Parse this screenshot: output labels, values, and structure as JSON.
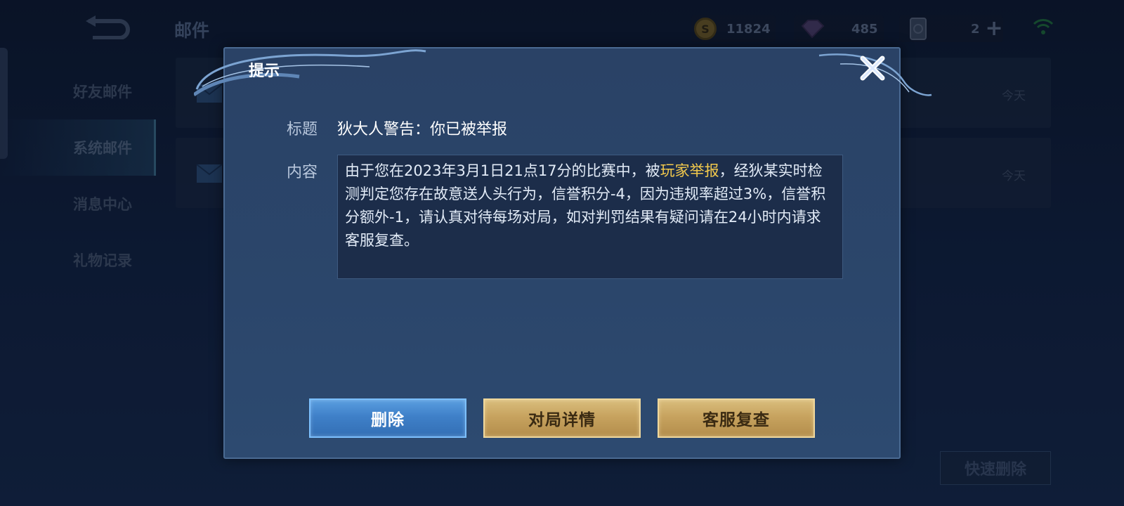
{
  "header": {
    "page_title": "邮件",
    "gold": "11824",
    "gems": "485",
    "tickets": "2"
  },
  "sidebar": {
    "items": [
      {
        "label": "好友邮件"
      },
      {
        "label": "系统邮件"
      },
      {
        "label": "消息中心"
      },
      {
        "label": "礼物记录"
      }
    ]
  },
  "mail_list": [
    {
      "date": "今天"
    },
    {
      "date": "今天"
    }
  ],
  "quick_delete_label": "快速删除",
  "dialog": {
    "title": "提示",
    "subject_label": "标题",
    "subject": "狄大人警告：你已被举报",
    "content_label": "内容",
    "content_part1": "由于您在2023年3月1日21点17分的比赛中，被",
    "content_highlight": "玩家举报",
    "content_part2": "，经狄某实时检测判定您存在故意送人头行为，信誉积分-4，因为违规率超过3%，信誉积分额外-1，请认真对待每场对局，如对判罚结果有疑问请在24小时内请求客服复查。",
    "buttons": {
      "delete": "删除",
      "match_detail": "对局详情",
      "service_review": "客服复查"
    }
  },
  "colors": {
    "highlight": "#f2c94c",
    "blue_button": "#3f80c8",
    "gold_button": "#c7a35f",
    "dialog_bg": "#2b466b"
  }
}
